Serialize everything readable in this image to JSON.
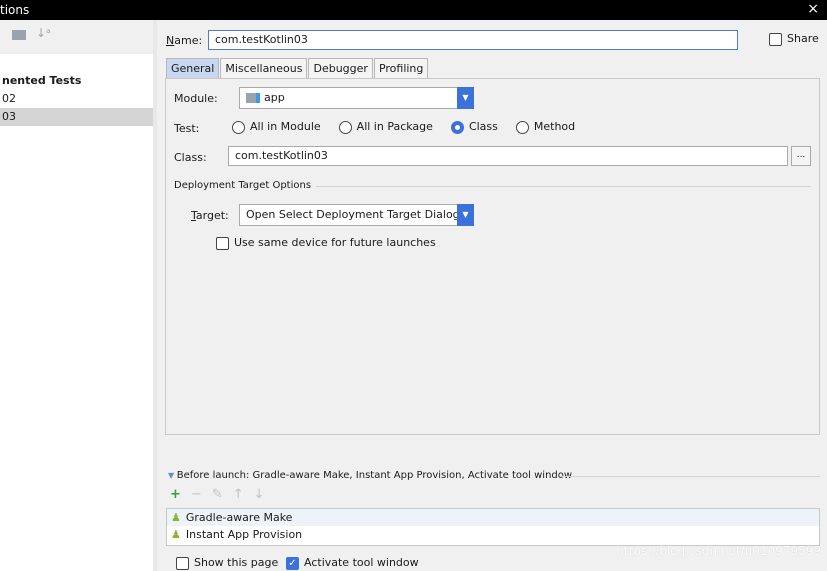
{
  "window": {
    "title": "tions",
    "close": "×"
  },
  "left": {
    "toolbar_icons": [
      "folder-icon",
      "sort-alpha-icon"
    ],
    "tree": [
      {
        "label": "nented Tests",
        "bold": true
      },
      {
        "label": "02"
      },
      {
        "label": "03",
        "selected": true
      }
    ]
  },
  "name": {
    "label": "Name:",
    "value": "com.testKotlin03",
    "share_label": "Share",
    "share_checked": false
  },
  "tabs": [
    {
      "label": "General",
      "active": true
    },
    {
      "label": "Miscellaneous"
    },
    {
      "label": "Debugger"
    },
    {
      "label": "Profiling"
    }
  ],
  "general": {
    "module_label": "Module:",
    "module_value": "app",
    "test_label": "Test:",
    "test_options": [
      {
        "label": "All in Module",
        "selected": false
      },
      {
        "label": "All in Package",
        "selected": false
      },
      {
        "label": "Class",
        "selected": true
      },
      {
        "label": "Method",
        "selected": false
      }
    ],
    "class_label": "Class:",
    "class_value": "com.testKotlin03",
    "browse_label": "...",
    "deploy_section": "Deployment Target Options",
    "target_label": "Target:",
    "target_value": "Open Select Deployment Target Dialog",
    "same_device_label": "Use same device for future launches",
    "same_device_checked": false
  },
  "before_launch": {
    "header": "Before launch: Gradle-aware Make, Instant App Provision, Activate tool window",
    "toolbar": [
      "add-icon",
      "remove-icon",
      "edit-icon",
      "move-up-icon",
      "move-down-icon"
    ],
    "items": [
      "Gradle-aware Make",
      "Instant App Provision"
    ]
  },
  "bottom": {
    "show_page_label": "Show this page",
    "show_page_checked": false,
    "activate_label": "Activate tool window",
    "activate_checked": true
  },
  "watermark": "https://blog.csdn.net/u010979599",
  "colors": {
    "accent": "#3a72d9",
    "tab_active": "#c6d7ef",
    "android": "#8ab531"
  }
}
